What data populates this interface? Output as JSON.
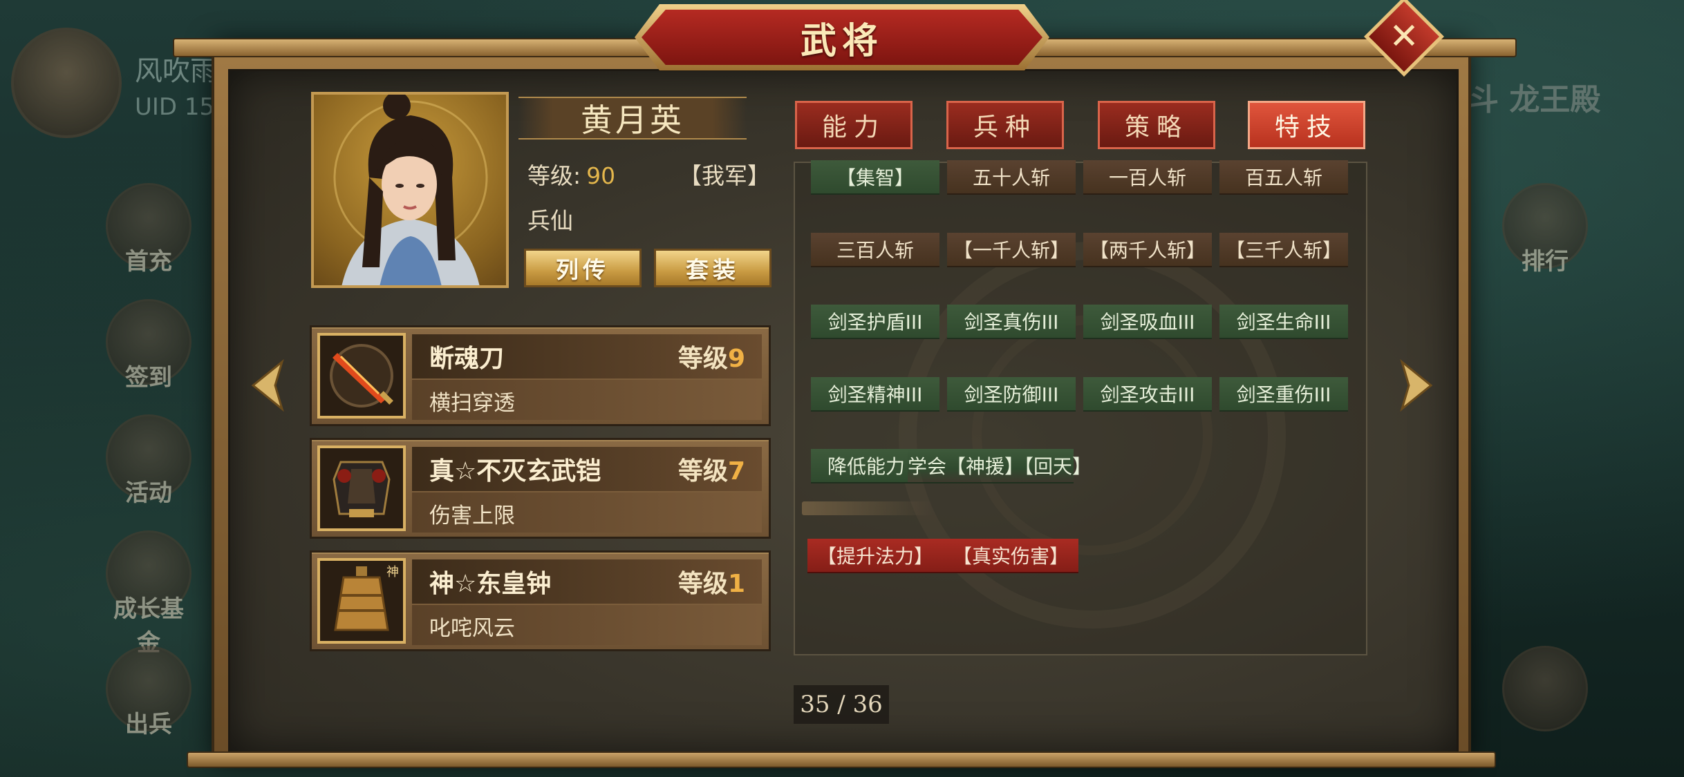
{
  "background": {
    "player_name": "风吹雨",
    "uid_label": "UID  15",
    "side_buttons": [
      {
        "label": "首充"
      },
      {
        "label": "签到"
      },
      {
        "label": "活动"
      },
      {
        "label": "成长基金"
      },
      {
        "label": "出兵"
      }
    ],
    "right_buttons": [
      {
        "label": "排行"
      }
    ],
    "right_banner": "乱斗 龙王殿"
  },
  "dialog": {
    "title": "武将",
    "close_icon": "close-x-icon"
  },
  "general": {
    "name": "黄月英",
    "level_label": "等级:",
    "level_value": "90",
    "faction_tag": "【我军】",
    "class_name": "兵仙",
    "buttons": {
      "biography": "列传",
      "gear_set": "套装"
    }
  },
  "equipment": [
    {
      "name": "断魂刀",
      "level_label": "等级",
      "level": "9",
      "desc": "横扫穿透",
      "icon": "saber-icon"
    },
    {
      "name": "真☆不灭玄武铠",
      "level_label": "等级",
      "level": "7",
      "desc": "伤害上限",
      "icon": "armor-icon"
    },
    {
      "name": "神☆东皇钟",
      "level_label": "等级",
      "level": "1",
      "desc": "叱咤风云",
      "icon": "bell-icon"
    }
  ],
  "tabs": [
    {
      "label": "能力",
      "active": false
    },
    {
      "label": "兵种",
      "active": false
    },
    {
      "label": "策略",
      "active": false
    },
    {
      "label": "特技",
      "active": true
    }
  ],
  "skills": {
    "row1": [
      "【集智】",
      "五十人斩",
      "一百人斩",
      "百五人斩"
    ],
    "row2": [
      "三百人斩",
      "【一千人斩】",
      "【两千人斩】",
      "【三千人斩】"
    ],
    "row3": [
      "剑圣护盾III",
      "剑圣真伤III",
      "剑圣吸血III",
      "剑圣生命III"
    ],
    "row4": [
      "剑圣精神III",
      "剑圣防御III",
      "剑圣攻击III",
      "剑圣重伤III"
    ],
    "row5": [
      "降低能力",
      "学会【神援】【回天】"
    ],
    "row6": [
      "【提升法力】",
      "【真实伤害】"
    ]
  },
  "pagination": {
    "text": "35 / 36"
  },
  "colors": {
    "accent_red": "#b52a22",
    "active_tab": "#e0553c",
    "gold": "#c99b43",
    "level_number": "#f0b145"
  }
}
